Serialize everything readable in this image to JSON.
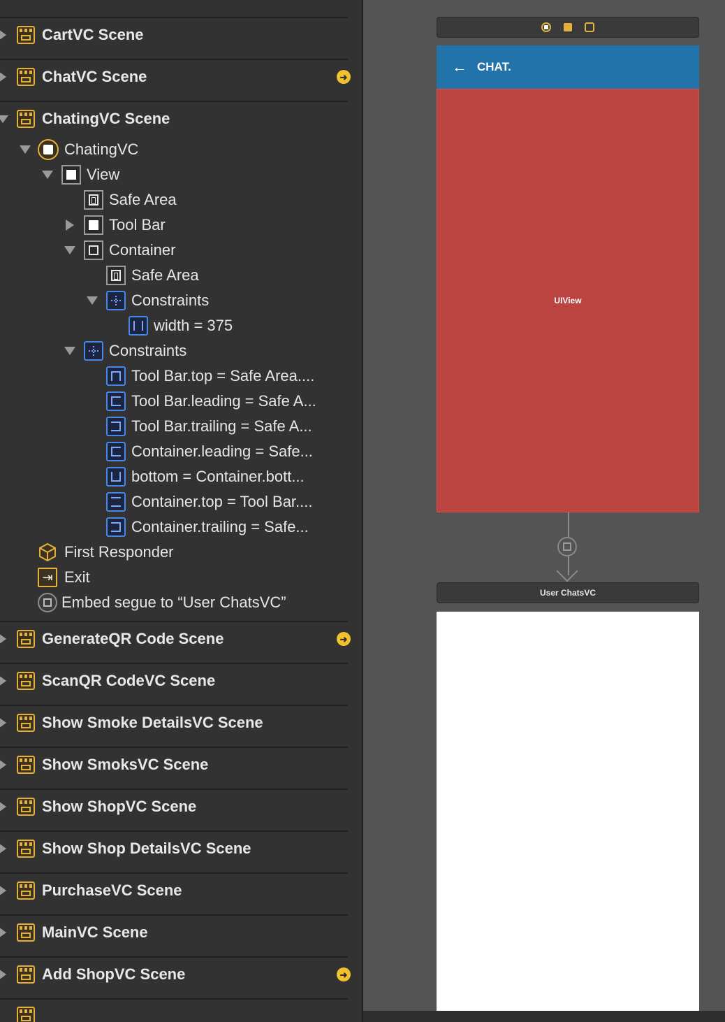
{
  "outline": {
    "scenes_top": [
      {
        "label": "CartVC Scene",
        "has_goto": false
      },
      {
        "label": "ChatVC Scene",
        "has_goto": true
      }
    ],
    "expanded_scene": {
      "label": "ChatingVC Scene",
      "items": [
        {
          "label": "ChatingVC",
          "icon": "view-controller-icon"
        },
        {
          "label": "View",
          "icon": "view-icon"
        },
        {
          "label": "Safe Area",
          "icon": "safe-area-icon"
        },
        {
          "label": "Tool Bar",
          "icon": "view-icon"
        },
        {
          "label": "Container",
          "icon": "container-view-icon"
        },
        {
          "label": "Safe Area",
          "icon": "safe-area-icon"
        },
        {
          "label": "Constraints",
          "icon": "constraints-icon"
        },
        {
          "label": "width = 375",
          "icon": "width-constraint-icon"
        },
        {
          "label": "Constraints",
          "icon": "constraints-icon"
        },
        {
          "label": "Tool Bar.top = Safe Area....",
          "icon": "top-constraint-icon"
        },
        {
          "label": "Tool Bar.leading = Safe A...",
          "icon": "leading-constraint-icon"
        },
        {
          "label": "Tool Bar.trailing = Safe A...",
          "icon": "trailing-constraint-icon"
        },
        {
          "label": "Container.leading = Safe...",
          "icon": "leading-constraint-icon"
        },
        {
          "label": "bottom = Container.bott...",
          "icon": "bottom-constraint-icon"
        },
        {
          "label": "Container.top = Tool Bar....",
          "icon": "vertical-spacing-constraint-icon"
        },
        {
          "label": "Container.trailing = Safe...",
          "icon": "trailing-constraint-icon"
        },
        {
          "label": "First Responder",
          "icon": "first-responder-icon"
        },
        {
          "label": "Exit",
          "icon": "exit-icon"
        },
        {
          "label": "Embed segue to “User ChatsVC”",
          "icon": "embed-segue-icon"
        }
      ]
    },
    "scenes_bottom": [
      {
        "label": "GenerateQR Code Scene",
        "has_goto": true
      },
      {
        "label": "ScanQR CodeVC Scene",
        "has_goto": false
      },
      {
        "label": "Show Smoke DetailsVC Scene",
        "has_goto": false
      },
      {
        "label": "Show SmoksVC Scene",
        "has_goto": false
      },
      {
        "label": "Show ShopVC Scene",
        "has_goto": false
      },
      {
        "label": "Show Shop DetailsVC Scene",
        "has_goto": false
      },
      {
        "label": "PurchaseVC Scene",
        "has_goto": false
      },
      {
        "label": "MainVC Scene",
        "has_goto": false
      },
      {
        "label": "Add ShopVC Scene",
        "has_goto": true
      }
    ]
  },
  "canvas": {
    "navbar_back": "←",
    "navbar_title": "CHAT.",
    "main_view_label": "UIView",
    "child_scene_title": "User ChatsVC",
    "colors": {
      "navbar": "#2273aa",
      "main_view": "#bb4340",
      "child_view": "#ffffff",
      "canvas_bg": "#545454"
    }
  }
}
